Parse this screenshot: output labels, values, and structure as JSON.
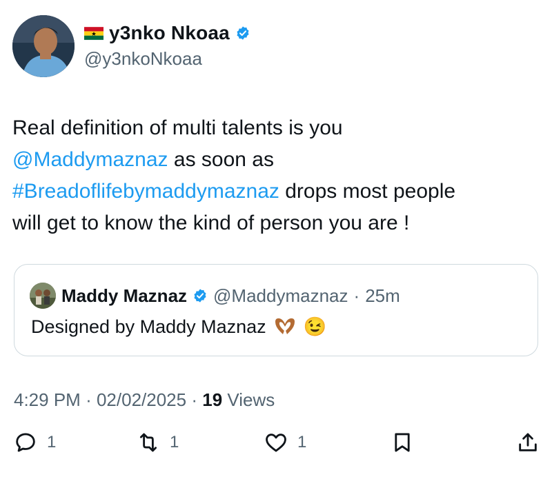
{
  "author": {
    "display_name": "y3nko Nkoaa",
    "handle": "@y3nkoNkoaa"
  },
  "tweet": {
    "text_line1": "Real definition of multi talents is you",
    "mention": "@Maddymaznaz",
    "text_line2_rest": " as soon as",
    "hashtag": "#Breadoflifebymaddymaznaz",
    "text_line3_rest": " drops most people",
    "text_line4": "will get to know the kind of person you are !"
  },
  "quote": {
    "name": "Maddy Maznaz",
    "handle": "@Maddymaznaz",
    "separator": "·",
    "time": "25m",
    "text": "Designed by Maddy Maznaz",
    "emoji_wink": "😉"
  },
  "meta": {
    "time": "4:29 PM",
    "separator": "·",
    "date": "02/02/2025",
    "views_count": "19",
    "views_label": "Views"
  },
  "actions": {
    "reply_count": "1",
    "retweet_count": "1",
    "like_count": "1"
  },
  "colors": {
    "link": "#1d9bf0",
    "verified": "#1d9bf0",
    "secondary_text": "#536471",
    "border": "#cfd9de"
  },
  "icons": [
    "ghana-flag-icon",
    "verified-badge-icon",
    "heart-hands-icon",
    "reply-icon",
    "retweet-icon",
    "like-icon",
    "bookmark-icon",
    "share-icon"
  ]
}
